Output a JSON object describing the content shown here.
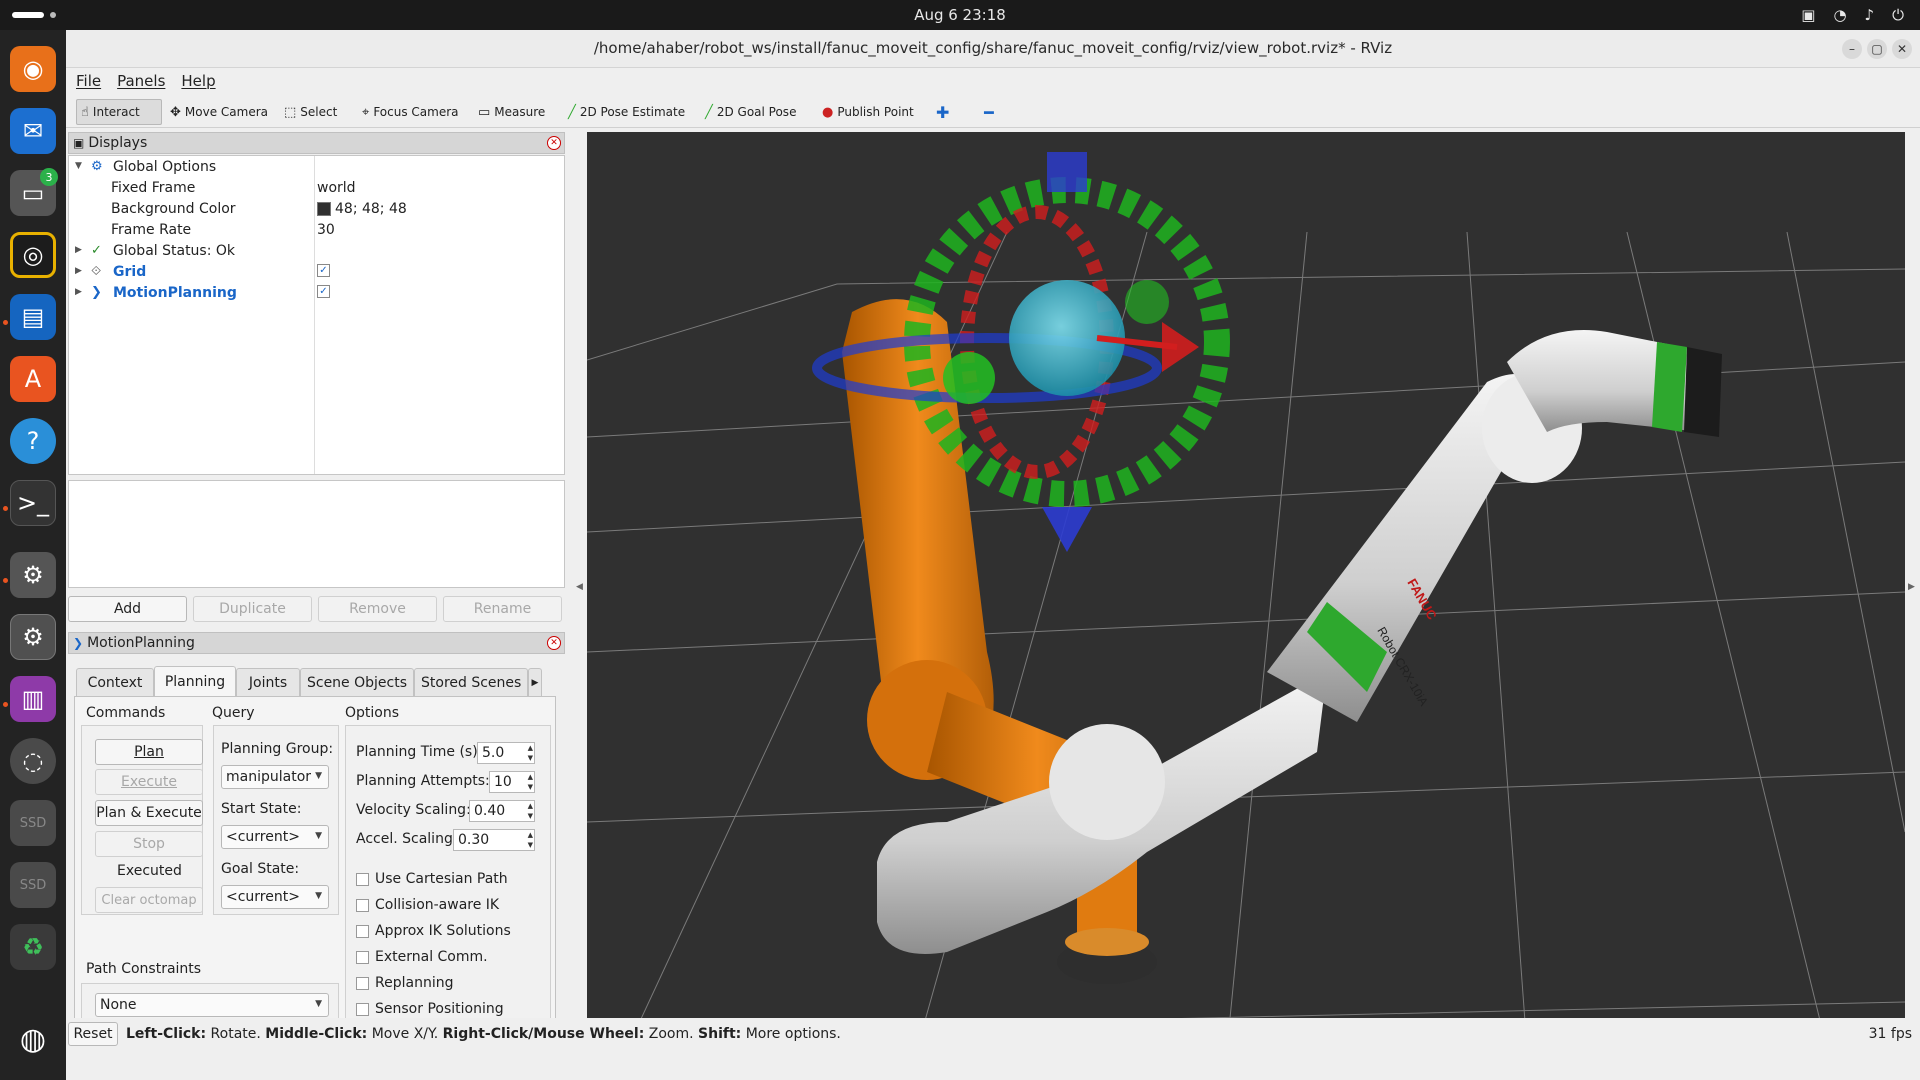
{
  "topbar": {
    "clock": "Aug 6  23:18"
  },
  "window": {
    "title": "/home/ahaber/robot_ws/install/fanuc_moveit_config/share/fanuc_moveit_config/rviz/view_robot.rviz* - RViz"
  },
  "menu": {
    "file": "File",
    "panels": "Panels",
    "help": "Help"
  },
  "toolbar": {
    "interact": "Interact",
    "move_camera": "Move Camera",
    "select": "Select",
    "focus_camera": "Focus Camera",
    "measure": "Measure",
    "pose_estimate": "2D Pose Estimate",
    "goal_pose": "2D Goal Pose",
    "publish_point": "Publish Point"
  },
  "displays": {
    "title": "Displays",
    "global_options": "Global Options",
    "fixed_frame_label": "Fixed Frame",
    "fixed_frame_value": "world",
    "bg_color_label": "Background Color",
    "bg_color_value": "48; 48; 48",
    "frame_rate_label": "Frame Rate",
    "frame_rate_value": "30",
    "global_status": "Global Status: Ok",
    "grid": "Grid",
    "motion_planning": "MotionPlanning",
    "buttons": {
      "add": "Add",
      "duplicate": "Duplicate",
      "remove": "Remove",
      "rename": "Rename"
    }
  },
  "motion_planning": {
    "title": "MotionPlanning",
    "tabs": [
      "Context",
      "Planning",
      "Joints",
      "Scene Objects",
      "Stored Scenes"
    ],
    "commands_label": "Commands",
    "query_label": "Query",
    "options_label": "Options",
    "plan": "Plan",
    "execute": "Execute",
    "plan_execute": "Plan & Execute",
    "stop": "Stop",
    "executed": "Executed",
    "clear_octomap": "Clear octomap",
    "planning_group_label": "Planning Group:",
    "planning_group_value": "manipulator",
    "start_state_label": "Start State:",
    "start_state_value": "<current>",
    "goal_state_label": "Goal State:",
    "goal_state_value": "<current>",
    "planning_time_label": "Planning Time (s):",
    "planning_time_value": "5.0",
    "planning_attempts_label": "Planning Attempts:",
    "planning_attempts_value": "10",
    "velocity_scaling_label": "Velocity Scaling:",
    "velocity_scaling_value": "0.40",
    "accel_scaling_label": "Accel. Scaling:",
    "accel_scaling_value": "0.30",
    "checkboxes": [
      "Use Cartesian Path",
      "Collision-aware IK",
      "Approx IK Solutions",
      "External Comm.",
      "Replanning",
      "Sensor Positioning"
    ],
    "path_constraints_label": "Path Constraints",
    "path_constraints_value": "None"
  },
  "robot": {
    "brand": "FANUC",
    "model": "Robot CRX-10iA"
  },
  "status": {
    "reset": "Reset",
    "left_click": "Left-Click:",
    "left_click_action": " Rotate. ",
    "middle_click": "Middle-Click:",
    "middle_click_action": " Move X/Y. ",
    "right_click": "Right-Click/Mouse Wheel:",
    "right_click_action": " Zoom. ",
    "shift": "Shift:",
    "shift_action": " More options.",
    "fps": "31 fps"
  },
  "colors": {
    "viewport_bg": "#303030",
    "orange_robot": "#e07b10",
    "accent_blue": "#1a66c8"
  }
}
